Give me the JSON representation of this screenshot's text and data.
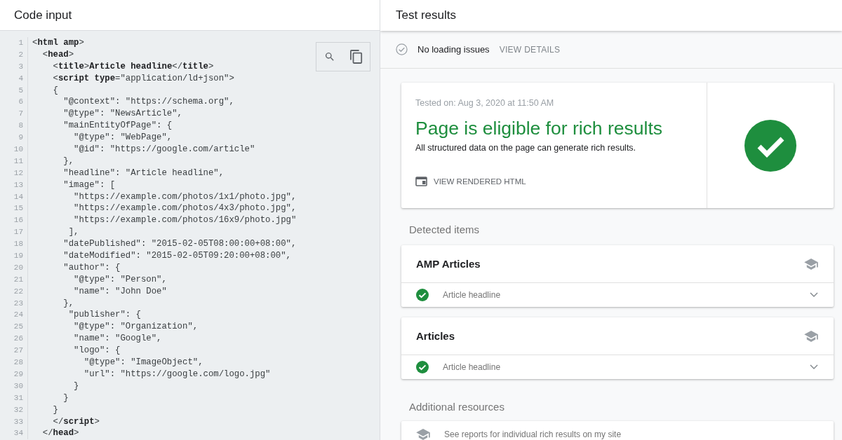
{
  "code_panel": {
    "title": "Code input",
    "lines": [
      {
        "number": "1",
        "text": "<**html amp**>"
      },
      {
        "number": "2",
        "text": "  <**head**>"
      },
      {
        "number": "3",
        "text": "    <**title**>**Article headline**</**title**>"
      },
      {
        "number": "4",
        "text": "    <**script type**=\"application/ld+json\">"
      },
      {
        "number": "5",
        "text": "    {"
      },
      {
        "number": "6",
        "text": "      \"@context\": \"https://schema.org\","
      },
      {
        "number": "7",
        "text": "      \"@type\": \"NewsArticle\","
      },
      {
        "number": "8",
        "text": "      \"mainEntityOfPage\": {"
      },
      {
        "number": "9",
        "text": "        \"@type\": \"WebPage\","
      },
      {
        "number": "10",
        "text": "        \"@id\": \"https://google.com/article\""
      },
      {
        "number": "11",
        "text": "      },"
      },
      {
        "number": "12",
        "text": "      \"headline\": \"Article headline\","
      },
      {
        "number": "13",
        "text": "      \"image\": ["
      },
      {
        "number": "14",
        "text": "        \"https://example.com/photos/1x1/photo.jpg\","
      },
      {
        "number": "15",
        "text": "        \"https://example.com/photos/4x3/photo.jpg\","
      },
      {
        "number": "16",
        "text": "        \"https://example.com/photos/16x9/photo.jpg\""
      },
      {
        "number": "17",
        "text": "       ],"
      },
      {
        "number": "18",
        "text": "      \"datePublished\": \"2015-02-05T08:00:00+08:00\","
      },
      {
        "number": "19",
        "text": "      \"dateModified\": \"2015-02-05T09:20:00+08:00\","
      },
      {
        "number": "20",
        "text": "      \"author\": {"
      },
      {
        "number": "21",
        "text": "        \"@type\": \"Person\","
      },
      {
        "number": "22",
        "text": "        \"name\": \"John Doe\""
      },
      {
        "number": "23",
        "text": "      },"
      },
      {
        "number": "24",
        "text": "       \"publisher\": {"
      },
      {
        "number": "25",
        "text": "        \"@type\": \"Organization\","
      },
      {
        "number": "26",
        "text": "        \"name\": \"Google\","
      },
      {
        "number": "27",
        "text": "        \"logo\": {"
      },
      {
        "number": "28",
        "text": "          \"@type\": \"ImageObject\","
      },
      {
        "number": "29",
        "text": "          \"url\": \"https://google.com/logo.jpg\""
      },
      {
        "number": "30",
        "text": "        }"
      },
      {
        "number": "31",
        "text": "      }"
      },
      {
        "number": "32",
        "text": "    }"
      },
      {
        "number": "33",
        "text": "    </**script**>"
      },
      {
        "number": "34",
        "text": "  </**head**>"
      }
    ]
  },
  "results_panel": {
    "title": "Test results",
    "loading": {
      "label": "No loading issues",
      "link": "VIEW DETAILS"
    },
    "summary": {
      "tested_on": "Tested on: Aug 3, 2020 at 11:50 AM",
      "headline": "Page is eligible for rich results",
      "description": "All structured data on the page can generate rich results.",
      "link": "VIEW RENDERED HTML"
    },
    "detected_heading": "Detected items",
    "detected_items": [
      {
        "title": "AMP Articles",
        "items": [
          {
            "label": "Article headline",
            "expanded": false
          }
        ]
      },
      {
        "title": "Articles",
        "items": [
          {
            "label": "Article headline",
            "expanded": false
          }
        ]
      }
    ],
    "resources_heading": "Additional resources",
    "resources": [
      {
        "label": "See reports for individual rich results on my site"
      }
    ]
  }
}
